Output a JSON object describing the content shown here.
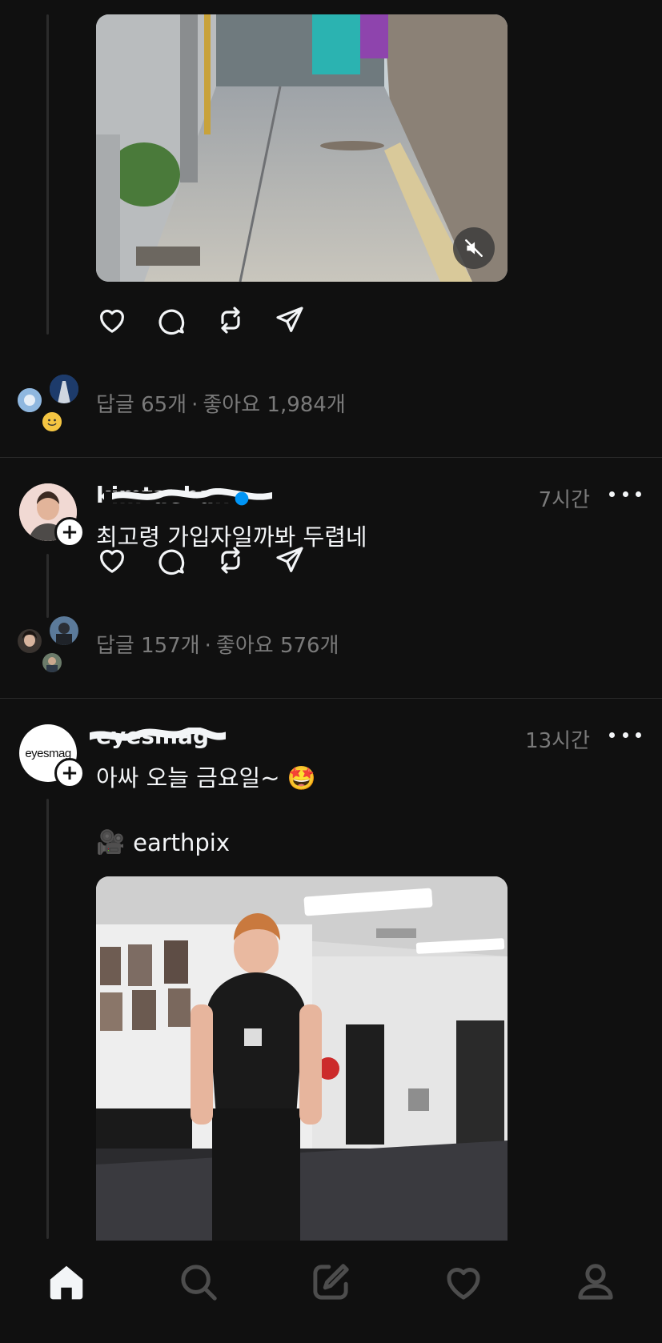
{
  "colors": {
    "background": "#101010",
    "text_primary": "#f3f5f7",
    "text_secondary": "#7a7a7a",
    "divider": "#2a2a2a",
    "verified_badge": "#0095f6"
  },
  "post1": {
    "stats": {
      "replies": "답글 65개",
      "separator": "·",
      "likes": "좋아요 1,984개"
    },
    "media_icon": "muted-speaker-icon"
  },
  "post2": {
    "username": "kimtaehan",
    "time": "7시간",
    "text": "최고령 가입자일까봐 두렵네",
    "stats": {
      "replies": "답글 157개",
      "separator": "·",
      "likes": "좋아요 576개"
    }
  },
  "post3": {
    "username": "eyesmag",
    "avatar_text": "eyesmag",
    "time": "13시간",
    "text": "아싸 오늘 금요일~",
    "emoji": "🤩",
    "repost": {
      "icon": "🎥",
      "author": "earthpix"
    }
  },
  "actions": {
    "like_icon": "heart-icon",
    "reply_icon": "comment-icon",
    "repost_icon": "repost-icon",
    "share_icon": "send-icon"
  },
  "nav": {
    "items": [
      "home-icon",
      "search-icon",
      "compose-icon",
      "activity-heart-icon",
      "profile-icon"
    ]
  }
}
